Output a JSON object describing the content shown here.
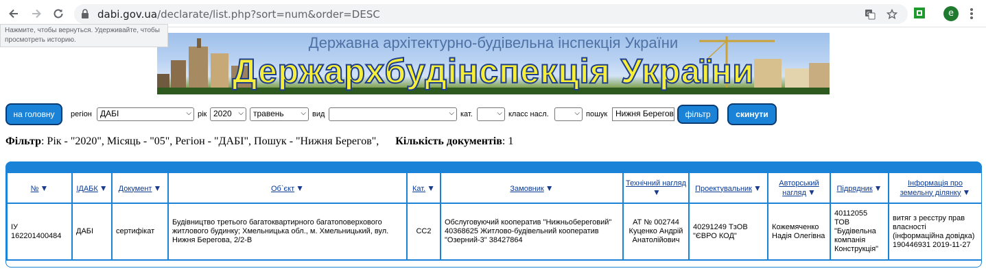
{
  "browser": {
    "url_host": "dabi.gov.ua",
    "url_path": "/declarate/list.php?sort=num&order=DESC",
    "avatar_letter": "e",
    "tooltip": "Нажмите, чтобы вернуться. Удерживайте, чтобы просмотреть историю."
  },
  "banner": {
    "subtitle": "Державна архітектурно-будівельна інспекція України",
    "title": "Держархбудінспекція України"
  },
  "form": {
    "home_button": "на головну",
    "region_label": "регіон",
    "region_value": "ДАБІ",
    "year_label": "рік",
    "year_value": "2020",
    "month_value": "травень",
    "type_label": "вид",
    "type_value": "",
    "cat_label": "кат.",
    "cat_value": "",
    "class_label": "класс насл.",
    "class_value": "",
    "search_label": "пошук",
    "search_value": "Нижня Берегов",
    "filter_button": "фільтр",
    "reset_button": "скинути"
  },
  "filter_summary": {
    "label": "Фільтр",
    "text": ": Рік - \"2020\", Місяць - \"05\", Регіон - \"ДАБІ\", Пошук - \"Нижня Берегов\",",
    "count_label": "Кількість документів",
    "count_value": ": 1"
  },
  "table": {
    "headers": [
      "№",
      "ІДАБК",
      "Документ",
      "Об`єкт",
      "Кат.",
      "Замовник",
      "Технічний нагляд",
      "Проектувальник",
      "Авторський нагляд",
      "Підрядник",
      "Інформація про земельну ділянку"
    ],
    "rows": [
      {
        "num": "ІУ 162201400484",
        "idabk": "ДАБІ",
        "doc": "сертифікат",
        "object": "Будівництво третього багатоквартирного багатоповерхового житлового будинку; Хмельницька обл., м. Хмельницький, вул. Нижня Берегова, 2/2-В",
        "cat": "СС2",
        "customer": "Обслуговуючий кооператив \"Нижньобереговий\" 40368625 Житлово-будівельний кооператив \"Озерний-3\" 38427864",
        "tech": "АТ № 002744 Куценко Андрій Анатолійович",
        "designer": "40291249 ТзОВ \"ЄВРО КОД\"",
        "author": "Кожемяченко Надія Олегівна",
        "contractor": "40112055 ТОВ \"Будівельна компанія Конструкція\"",
        "land": "витяг з реєстру прав власності (інформаційна довідка) 190446931 2019-11-27"
      }
    ]
  }
}
